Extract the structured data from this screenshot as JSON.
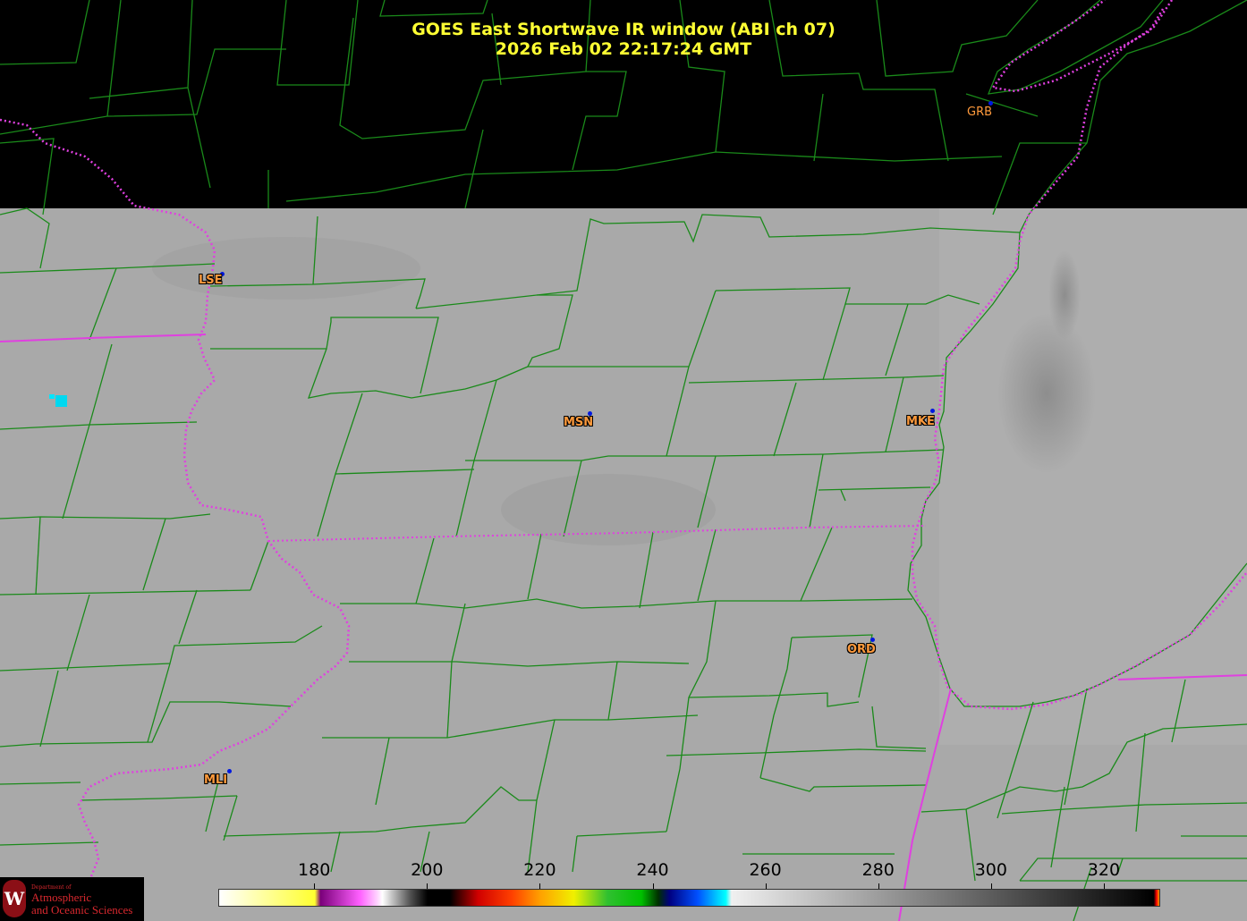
{
  "title": {
    "line1": "GOES East Shortwave IR window (ABI ch 07)",
    "line2": "2026 Feb 02  22:17:24 GMT"
  },
  "colors": {
    "title": "#ffff33",
    "county_lines": "#1a8a1a",
    "state_lines": "#e040e0",
    "city_label": "#ff9a3c",
    "station_dot": "#0018e0",
    "no_data": "#000000",
    "cold_pixel": "#00e5ff"
  },
  "cities": [
    {
      "id": "GRB",
      "label": "GRB"
    },
    {
      "id": "LSE",
      "label": "LSE"
    },
    {
      "id": "MSN",
      "label": "MSN"
    },
    {
      "id": "MKE",
      "label": "MKE"
    },
    {
      "id": "ORD",
      "label": "ORD"
    },
    {
      "id": "MLI",
      "label": "MLI"
    }
  ],
  "colorbar": {
    "min": 163,
    "max": 330,
    "ticks": [
      "180",
      "200",
      "220",
      "240",
      "260",
      "280",
      "300",
      "320"
    ],
    "stops": [
      {
        "t": 163,
        "c": "#ffffff"
      },
      {
        "t": 180,
        "c": "#ffff30"
      },
      {
        "t": 181,
        "c": "#7a007a"
      },
      {
        "t": 188,
        "c": "#ff60ff"
      },
      {
        "t": 191,
        "c": "#ffd0ff"
      },
      {
        "t": 192,
        "c": "#ffffff"
      },
      {
        "t": 197,
        "c": "#505050"
      },
      {
        "t": 200,
        "c": "#000000"
      },
      {
        "t": 204,
        "c": "#000000"
      },
      {
        "t": 209,
        "c": "#d00000"
      },
      {
        "t": 215,
        "c": "#ff4000"
      },
      {
        "t": 220,
        "c": "#ffa000"
      },
      {
        "t": 226,
        "c": "#f0f000"
      },
      {
        "t": 232,
        "c": "#30c030"
      },
      {
        "t": 238,
        "c": "#00c000"
      },
      {
        "t": 241,
        "c": "#003000"
      },
      {
        "t": 243,
        "c": "#000080"
      },
      {
        "t": 248,
        "c": "#0050ff"
      },
      {
        "t": 253,
        "c": "#00ffff"
      },
      {
        "t": 254,
        "c": "#f0f0f0"
      },
      {
        "t": 329,
        "c": "#000000"
      },
      {
        "t": 329.5,
        "c": "#ff0000"
      },
      {
        "t": 330,
        "c": "#ffa000"
      }
    ]
  },
  "logo": {
    "department": "Department of",
    "line1": "Atmospheric",
    "line2": "and Oceanic Sciences",
    "seal_letter": "W"
  }
}
